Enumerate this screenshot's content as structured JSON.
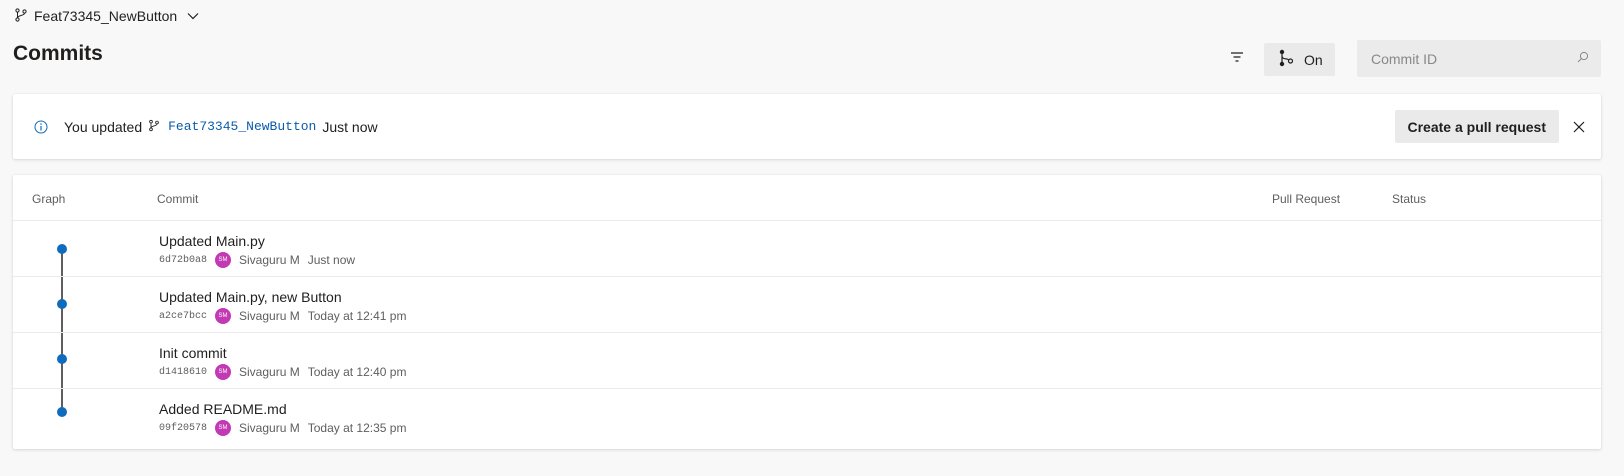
{
  "header": {
    "branch": "Feat73345_NewButton",
    "title": "Commits",
    "graph_toggle_label": "On",
    "search_placeholder": "Commit ID"
  },
  "banner": {
    "prefix": "You updated",
    "branch": "Feat73345_NewButton",
    "suffix": "Just now",
    "pr_button": "Create a pull request"
  },
  "table": {
    "columns": {
      "graph": "Graph",
      "commit": "Commit",
      "pull_request": "Pull Request",
      "status": "Status"
    },
    "rows": [
      {
        "message": "Updated Main.py",
        "hash": "6d72b0a8",
        "author": "Sivaguru M",
        "initials": "SM",
        "time": "Just now"
      },
      {
        "message": "Updated Main.py, new Button",
        "hash": "a2ce7bcc",
        "author": "Sivaguru M",
        "initials": "SM",
        "time": "Today at 12:41 pm"
      },
      {
        "message": "Init commit",
        "hash": "d1418610",
        "author": "Sivaguru M",
        "initials": "SM",
        "time": "Today at 12:40 pm"
      },
      {
        "message": "Added README.md",
        "hash": "09f20578",
        "author": "Sivaguru M",
        "initials": "SM",
        "time": "Today at 12:35 pm"
      }
    ]
  },
  "colors": {
    "accent": "#0f6cbd",
    "link": "#0b5cad",
    "avatar": "#c239b3",
    "graph_line": "#605e5c"
  }
}
